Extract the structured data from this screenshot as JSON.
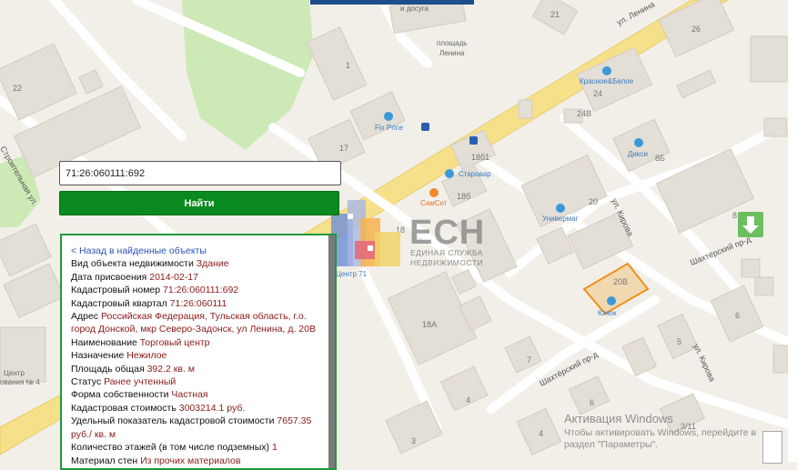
{
  "search": {
    "value": "71:26:060111:692",
    "find_label": "Найти"
  },
  "map": {
    "labels": {
      "square_1": "площадь",
      "square_2": "Ленина",
      "top_poi": "и досуга",
      "lenina_street": "ул. Ленина",
      "kirova_street_1": "ул. Кирова",
      "kirova_street_2": "ул. Кирова",
      "shakhtersky_1": "Шахтёрский пр-д",
      "shakhtersky_2": "Шахтёрский пр-д",
      "stroitelnaya": "Строительная ул.",
      "fix_price": "Fix Price",
      "krasnoe_beloe": "Красное&Белое",
      "starovar": "Старовар",
      "samset": "СамСет",
      "univermag": "Универмаг",
      "diksi": "Дикси",
      "centr71": "Центр 71",
      "tsentr_1": "Центр",
      "tsentr_2": "ования № 4",
      "yunok": "Юнок"
    },
    "numbers": [
      "21",
      "26",
      "1",
      "22",
      "24",
      "24В",
      "17",
      "18б1",
      "18б",
      "20",
      "8Б",
      "8",
      "18",
      "18А",
      "20В",
      "6",
      "7",
      "5",
      "4",
      "3",
      "6",
      "3/11",
      "2",
      "4"
    ]
  },
  "logo": {
    "main": "ЕСН",
    "sub1": "ЕДИНАЯ СЛУЖБА",
    "sub2": "НЕДВИЖИМОСТИ"
  },
  "info": {
    "back_link": "< Назад в найденные объекты",
    "rows": [
      {
        "k": "Вид объекта недвижимости",
        "v": "Здание"
      },
      {
        "k": "Дата присвоения",
        "v": "2014-02-17"
      },
      {
        "k": "Кадастровый номер",
        "v": "71:26:060111:692"
      },
      {
        "k": "Кадастровый квартал",
        "v": "71:26:060111"
      },
      {
        "k": "Адрес",
        "v": "Российская Федерация, Тульская область, г.о. город Донской, мкр Северо-Задонск, ул Ленина, д. 20В"
      },
      {
        "k": "Наименование",
        "v": "Торговый центр"
      },
      {
        "k": "Назначение",
        "v": "Нежилое"
      },
      {
        "k": "Площадь общая",
        "v": "392.2 кв. м"
      },
      {
        "k": "Статус",
        "v": "Ранее учтенный"
      },
      {
        "k": "Форма собственности",
        "v": "Частная"
      },
      {
        "k": "Кадастровая стоимость",
        "v": "3003214.1 руб."
      },
      {
        "k": "Удельный показатель кадастровой стоимости",
        "v": "7657.35 руб./ кв. м"
      },
      {
        "k": "Количество этажей (в том числе подземных)",
        "v": "1"
      },
      {
        "k": "Материал стен",
        "v": "Из прочих материалов"
      }
    ]
  },
  "watermark": {
    "title": "Активация Windows",
    "body": "Чтобы активировать Windows, перейдите в раздел \"Параметры\"."
  },
  "colors": {
    "find_button": "#0a8a1e",
    "panel_border": "#1d9b3a",
    "value_text": "#8b1a1a",
    "selected_parcel": "#f0901a",
    "road": "#f7e08a"
  },
  "icons": {
    "arrow_button": "arrow-down-icon",
    "shop": "shopping-bag-icon",
    "bus": "bus-stop-icon"
  }
}
